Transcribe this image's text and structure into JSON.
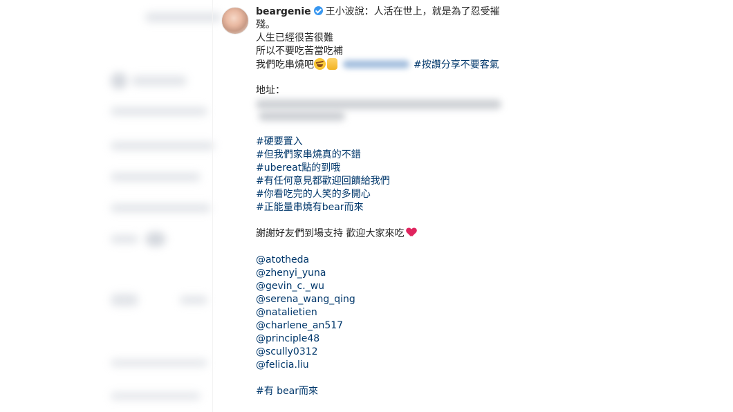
{
  "post": {
    "username": "beargenie",
    "verified": true,
    "caption_first": "王小波說：人活在世上，就是為了忍受摧",
    "caption_wrap": "殘。",
    "line_1": "人生已經很苦很難",
    "line_2": "所以不要吃苦當吃補",
    "line_3_text": "我們吃串燒吧",
    "line_3_hashtag": "#按讚分享不要客氣",
    "address_label": "地址：",
    "hashtags": [
      "#硬要置入",
      "#但我們家串燒真的不錯",
      "#ubereat點的到哦",
      "#有任何意見都歡迎回饋給我們",
      "#你看吃完的人笑的多開心",
      "#正能量串燒有bear而來"
    ],
    "thanks": "謝謝好友們到場支持 歡迎大家來吃",
    "mentions": [
      "@atotheda",
      "@zhenyi_yuna",
      "@gevin_c._wu",
      "@serena_wang_qing",
      "@natalietien",
      "@charlene_an517",
      "@principle48",
      "@scully0312",
      "@felicia.liu"
    ],
    "last_hashtag": "#有 bear而來",
    "icons": {
      "verified": "verified-badge-icon",
      "emoji_1": "rolling-laugh-emoji-icon",
      "emoji_2": "thumbs-up-emoji-icon",
      "heart": "red-heart-icon"
    }
  },
  "colors": {
    "text": "#262626",
    "link": "#00376b",
    "verified": "#3897f0",
    "heart": "#e0245e"
  }
}
